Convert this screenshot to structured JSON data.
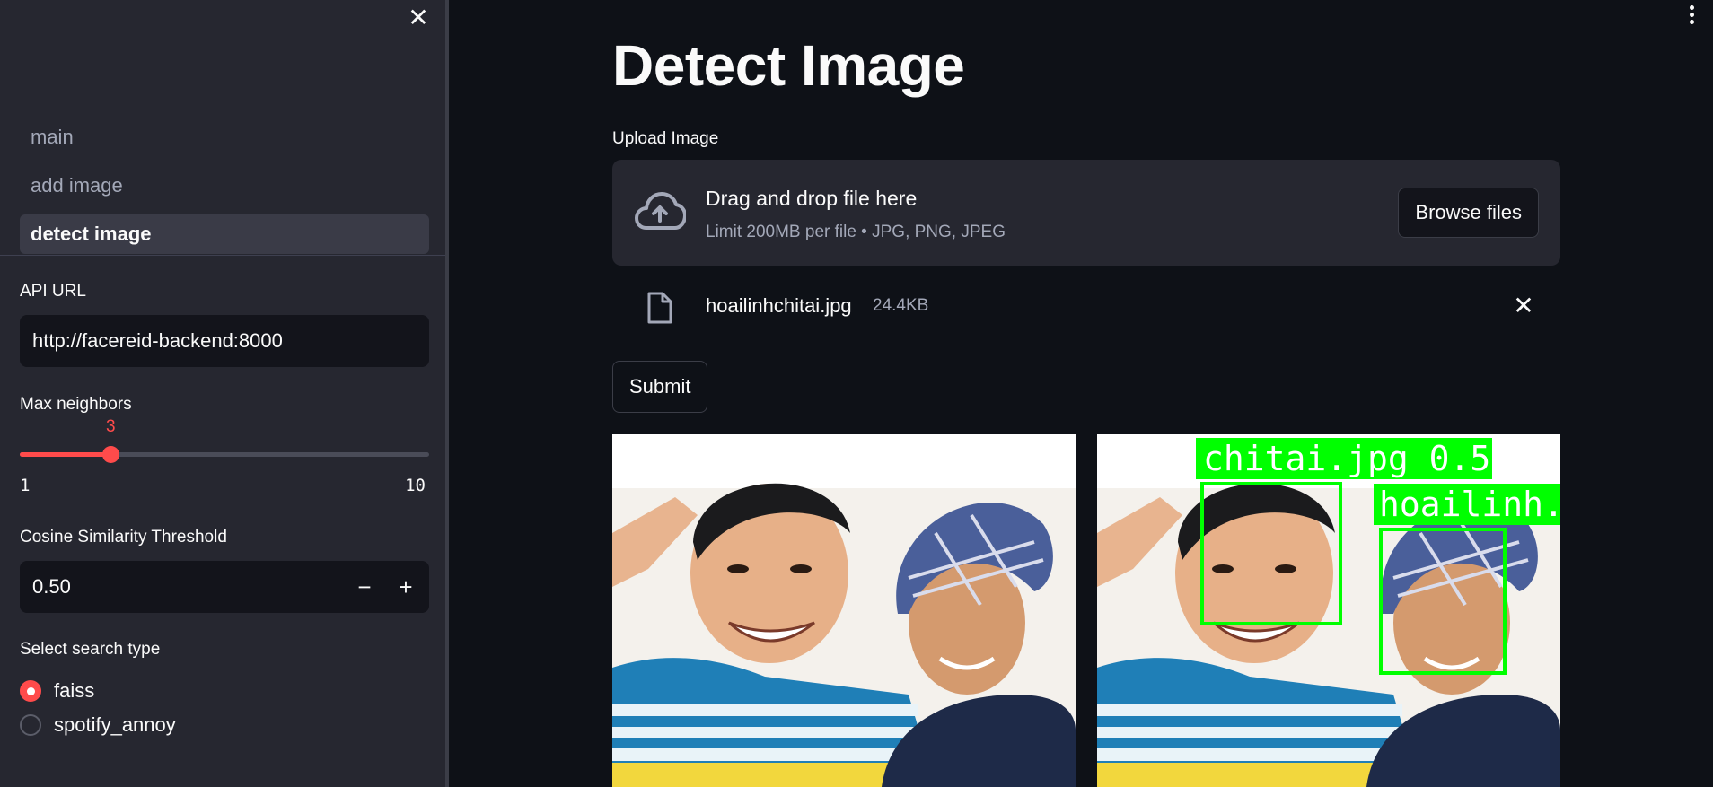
{
  "sidebar": {
    "nav": [
      {
        "label": "main"
      },
      {
        "label": "add image"
      },
      {
        "label": "detect image"
      }
    ],
    "api_url": {
      "label": "API URL",
      "value": "http://facereid-backend:8000"
    },
    "max_neighbors": {
      "label": "Max neighbors",
      "value": "3",
      "min": "1",
      "max": "10",
      "fraction": 0.2222
    },
    "threshold": {
      "label": "Cosine Similarity Threshold",
      "value": "0.50"
    },
    "search_type": {
      "label": "Select search type",
      "options": [
        {
          "label": "faiss",
          "checked": true
        },
        {
          "label": "spotify_annoy",
          "checked": false
        }
      ]
    }
  },
  "main": {
    "title": "Detect Image",
    "upload": {
      "label": "Upload Image",
      "drop_title": "Drag and drop file here",
      "drop_hint": "Limit 200MB per file • JPG, PNG, JPEG",
      "browse_label": "Browse files"
    },
    "file": {
      "name": "hoailinhchitai.jpg",
      "size": "24.4KB"
    },
    "submit_label": "Submit",
    "detections": [
      {
        "label": "chitai.jpg 0.51"
      },
      {
        "label": "hoailinh.j"
      }
    ]
  },
  "colors": {
    "accent": "#ff4b4b",
    "background": "#0e1117",
    "sidebar": "#262730",
    "detection_box": "#00ff00"
  }
}
